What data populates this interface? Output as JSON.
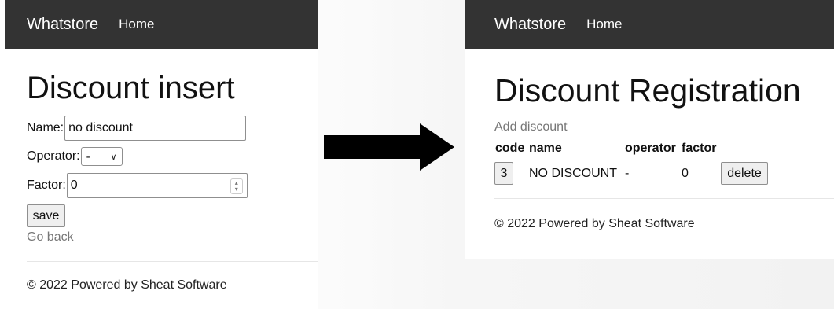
{
  "left": {
    "navbar": {
      "brand": "Whatstore",
      "home": "Home"
    },
    "title": "Discount insert",
    "form": {
      "name_label": "Name:",
      "name_value": "no discount",
      "operator_label": "Operator:",
      "operator_value": "-",
      "factor_label": "Factor:",
      "factor_value": "0",
      "save_label": "save"
    },
    "go_back": "Go back",
    "footer": "© 2022 Powered by Sheat Software"
  },
  "right": {
    "navbar": {
      "brand": "Whatstore",
      "home": "Home"
    },
    "title": "Discount Registration",
    "add_link": "Add discount",
    "table": {
      "headers": [
        "code",
        "name",
        "operator",
        "factor"
      ],
      "rows": [
        {
          "code": "3",
          "name": "NO DISCOUNT",
          "operator": "-",
          "factor": "0",
          "action": "delete"
        }
      ]
    },
    "footer": "© 2022 Powered by Sheat Software"
  },
  "icons": {
    "arrow": "right-arrow-icon",
    "select_chevron": "chevron-down-icon",
    "number_spinner": "spinner-icon"
  },
  "colors": {
    "navbar_bg": "#333333",
    "navbar_text": "#ffffff",
    "muted_link": "#777777",
    "button_bg": "#efefef"
  }
}
